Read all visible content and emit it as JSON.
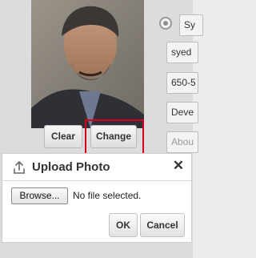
{
  "profile": {
    "photo_buttons": {
      "clear_label": "Clear",
      "change_label": "Change"
    },
    "fields": {
      "system_value": "Sy",
      "username_value": "syed",
      "phone_value": "650-5",
      "department_value": "Deve",
      "about_placeholder": "Abou"
    }
  },
  "upload_dialog": {
    "title": "Upload Photo",
    "browse_label": "Browse...",
    "file_status": "No file selected.",
    "ok_label": "OK",
    "cancel_label": "Cancel",
    "icons": {
      "upload": "upload-icon",
      "close": "close-icon"
    }
  },
  "colors": {
    "highlight": "#d6001c"
  }
}
